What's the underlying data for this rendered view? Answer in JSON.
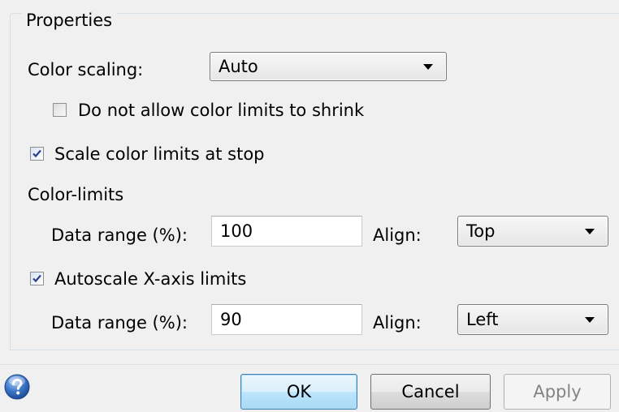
{
  "group": {
    "title": "Properties"
  },
  "color_scaling": {
    "label": "Color scaling:",
    "value": "Auto"
  },
  "checkboxes": {
    "no_shrink": {
      "label": "Do not allow color limits to shrink",
      "checked": false
    },
    "scale_at_stop": {
      "label": "Scale color limits at stop",
      "checked": true
    },
    "autoscale_x": {
      "label": "Autoscale X-axis limits",
      "checked": true
    }
  },
  "color_limits": {
    "heading": "Color-limits",
    "data_range_label": "Data range (%):",
    "data_range_value": "100",
    "align_label": "Align:",
    "align_value": "Top"
  },
  "x_axis": {
    "data_range_label": "Data range (%):",
    "data_range_value": "90",
    "align_label": "Align:",
    "align_value": "Left"
  },
  "buttons": {
    "ok": "OK",
    "cancel": "Cancel",
    "apply": "Apply"
  },
  "icons": {
    "help": "help-icon",
    "dropdown": "chevron-down-icon",
    "check": "check-icon"
  },
  "colors": {
    "background": "#f0f0f0",
    "default_button_border": "#3c7fb1",
    "check_mark": "#2b3f8c"
  }
}
